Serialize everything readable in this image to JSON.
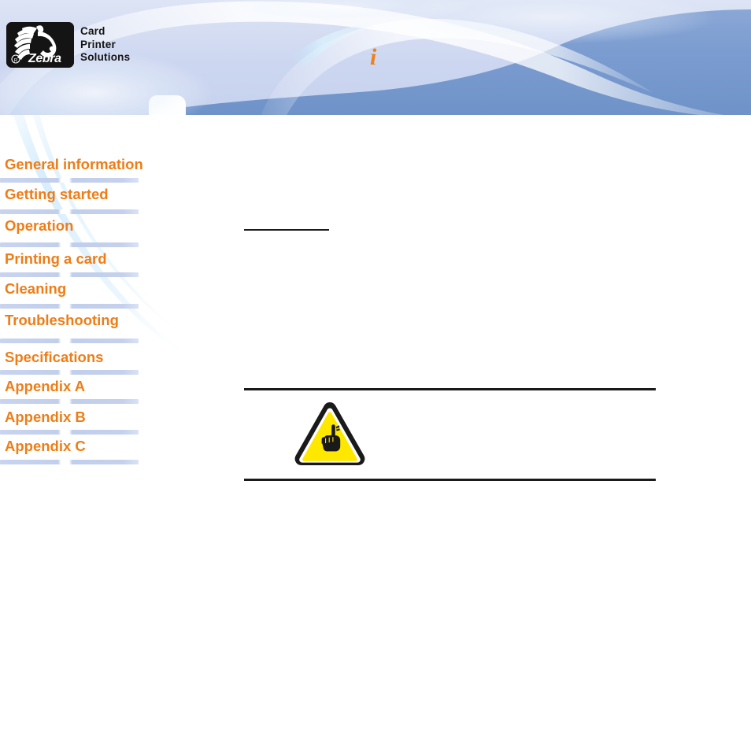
{
  "header": {
    "logo_alt": "Zebra",
    "logo_registered_mark": "®",
    "logo_wordmark": "Zebra",
    "brand_lines": [
      "Card",
      "Printer",
      "Solutions"
    ],
    "banner_glyph": "i"
  },
  "sidebar": {
    "items": [
      {
        "label": "General information"
      },
      {
        "label": "Getting started"
      },
      {
        "label": "Operation"
      },
      {
        "label": "Printing a card"
      },
      {
        "label": "Cleaning"
      },
      {
        "label": "Troubleshooting"
      },
      {
        "label": "Specifications"
      },
      {
        "label": "Appendix A"
      },
      {
        "label": "Appendix B"
      },
      {
        "label": "Appendix C"
      }
    ]
  },
  "content": {
    "heading": "",
    "warning": {
      "icon": "warning-triangle-hand-icon",
      "text": ""
    }
  },
  "colors": {
    "accent_orange": "#ee7d17",
    "banner_blue": "#7194ca",
    "banner_lavender": "#ccd6f0",
    "rule_black": "#1a1a1a",
    "warning_yellow": "#ffe800",
    "divider_blue": "#c4d0ec"
  }
}
